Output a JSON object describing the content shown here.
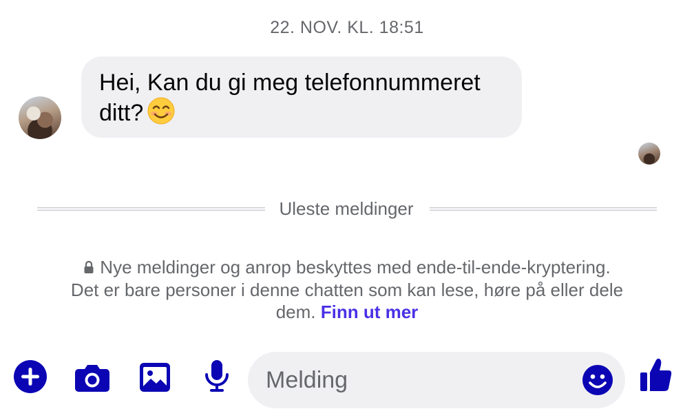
{
  "chat": {
    "timestamp": "22. NOV. KL. 18:51",
    "message": {
      "text": "Hei, Kan du gi meg telefonnummeret ditt?",
      "emoji": "smiling-face-icon"
    },
    "unread_divider": "Uleste meldinger",
    "encryption_notice": {
      "text": "Nye meldinger og anrop beskyttes med ende-til-ende-kryptering. Det er bare personer i denne chatten som kan lese, høre på eller dele dem.",
      "link": "Finn ut mer"
    }
  },
  "composer": {
    "placeholder": "Melding",
    "value": "",
    "icons": [
      "plus-icon",
      "camera-icon",
      "image-icon",
      "microphone-icon",
      "emoji-icon",
      "thumbs-up-icon"
    ]
  },
  "colors": {
    "accent": "#0b05b4",
    "link": "#4a31e6",
    "bubble": "#f0f0f3",
    "muted_text": "#65676b"
  }
}
